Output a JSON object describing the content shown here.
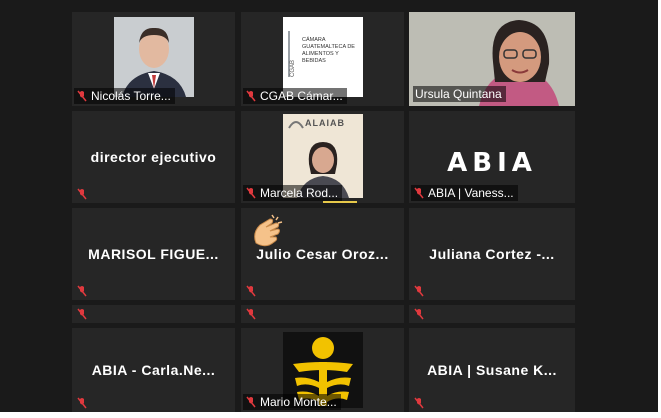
{
  "colors": {
    "active_speaker": "#c4e35a",
    "muted_icon": "#e0393e",
    "tile": "#262626"
  },
  "row1": [
    {
      "name": "Nicolás Torre...",
      "avatar": "man-in-suit-photo"
    },
    {
      "name": "CGAB Cámar...",
      "logo_text": "CÁMARA GUATEMALTECA DE ALIMENTOS Y BEBIDAS",
      "logo_tag": "CGAB"
    },
    {
      "name": "Ursula Quintana",
      "avatar": "woman-with-glasses-video"
    }
  ],
  "row2": [
    {
      "center": "director ejecutivo"
    },
    {
      "name": "Marcela Rod...",
      "logo_text": "ALAIAB"
    },
    {
      "name": "ABIA | Vaness...",
      "logo_text": "ABIA"
    }
  ],
  "row3": [
    {
      "center": "MARISOL  FIGUE..."
    },
    {
      "center": "Julio  Cesar  Oroz...",
      "reaction": "clapping-hands"
    },
    {
      "center": "Juliana  Cortez  -..."
    }
  ],
  "row5": [
    {
      "center": "ABIA  -  Carla.Ne..."
    },
    {
      "name": "Mario Monte...",
      "avatar": "yellow-logo"
    },
    {
      "center": "ABIA  |  Susane  K..."
    }
  ]
}
